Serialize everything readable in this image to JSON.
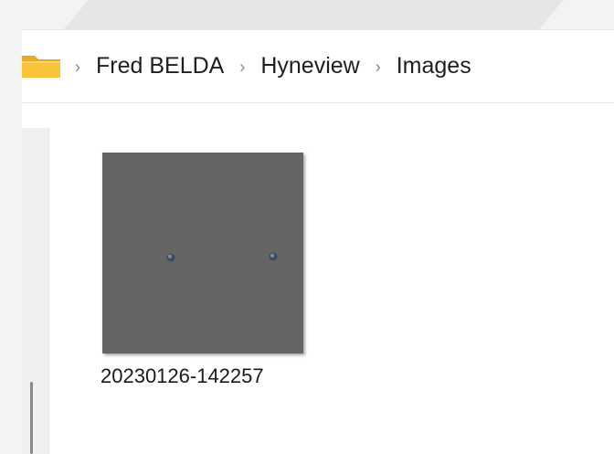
{
  "breadcrumb": {
    "items": [
      {
        "label": "Fred BELDA"
      },
      {
        "label": "Hyneview"
      },
      {
        "label": "Images"
      }
    ],
    "separator": "›"
  },
  "files": [
    {
      "name": "20230126-142257",
      "thumbnail_color": "#656565"
    }
  ],
  "colors": {
    "folder": "#f8c43a",
    "folder_back": "#e9a82a",
    "chrome": "#f3f3f3",
    "text": "#1f1f1f"
  },
  "icons": {
    "folder": "folder-icon",
    "separator": "chevron-right-icon"
  }
}
